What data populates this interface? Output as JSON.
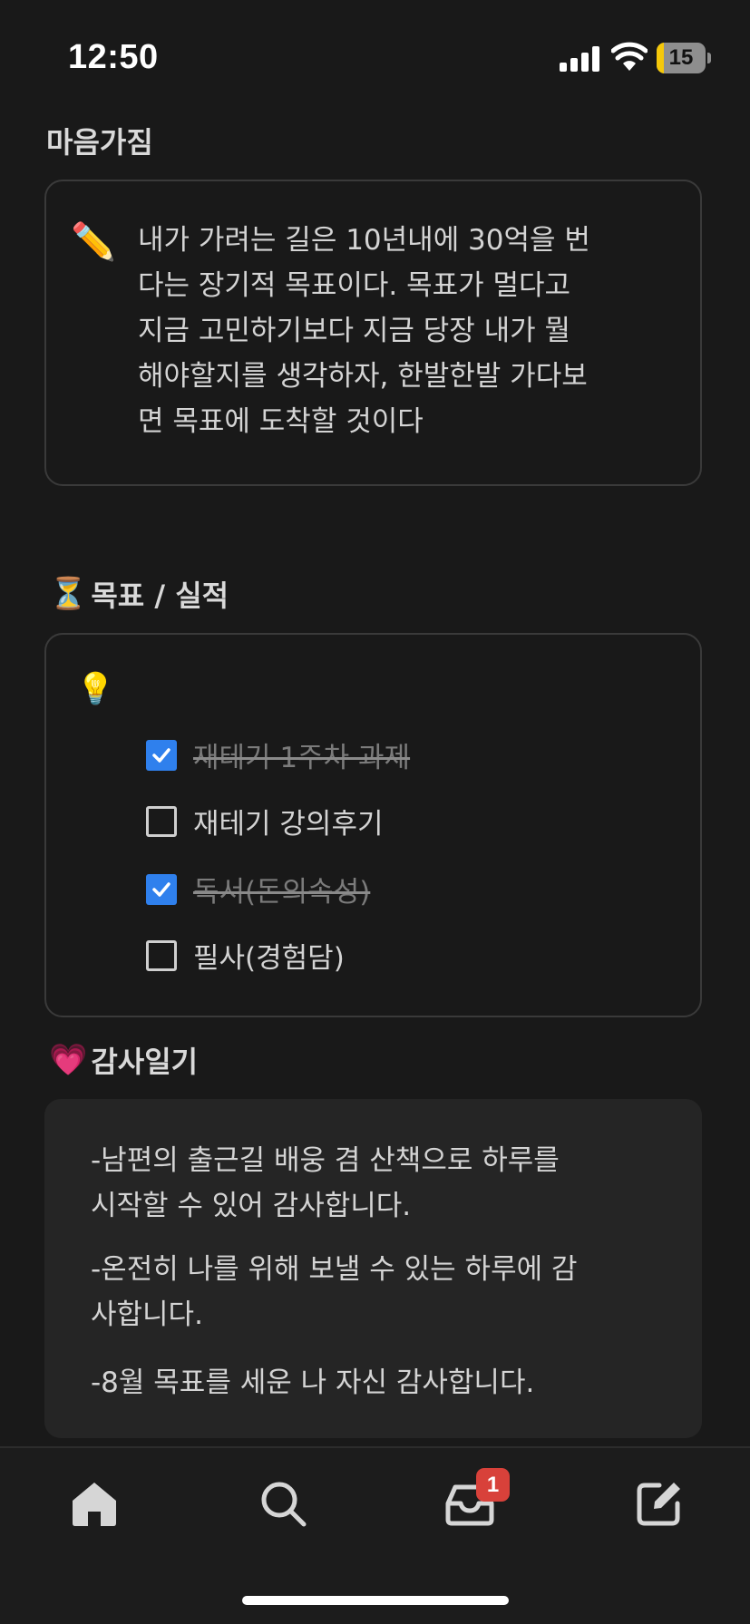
{
  "status_bar": {
    "time": "12:50",
    "battery_level": "15",
    "battery_fraction": 0.15,
    "icons": [
      "signal-icon",
      "wifi-icon",
      "battery-icon"
    ]
  },
  "mindset": {
    "title": "마음가짐",
    "icon": "pencil-icon",
    "lines": [
      "내가 가려는 길은 10년내에 30억을 번",
      "다는 장기적 목표이다. 목표가 멀다고",
      "지금 고민하기보다 지금 당장 내가 뭘",
      "해야할지를 생각하자, 한발한발 가다보",
      "면 목표에 도착할 것이다"
    ]
  },
  "goals": {
    "emoji": "⏳",
    "title": "목표 / 실적",
    "icon": "lightbulb-icon",
    "items": [
      {
        "label": "재테기 1주차 과제",
        "checked": true
      },
      {
        "label": "재테기 강의후기",
        "checked": false
      },
      {
        "label": "독서(돈의속성)",
        "checked": true
      },
      {
        "label": "필사(경험담)",
        "checked": false
      }
    ]
  },
  "gratitude": {
    "emoji": "💗",
    "title": "감사일기",
    "lines": [
      "-남편의 출근길 배웅 겸 산책으로 하루를",
      "시작할 수 있어 감사합니다.",
      "-온전히 나를 위해 보낼 수 있는 하루에 감",
      "사합니다.",
      "-8월 목표를 세운 나 자신 감사합니다."
    ]
  },
  "bottom_nav": {
    "items": [
      "home-icon",
      "search-icon",
      "inbox-icon",
      "compose-icon"
    ],
    "inbox_badge": "1"
  },
  "colors": {
    "background": "#191919",
    "checkbox_checked": "#2f80ed",
    "badge": "#d8413a",
    "battery": "#f5c80a"
  }
}
